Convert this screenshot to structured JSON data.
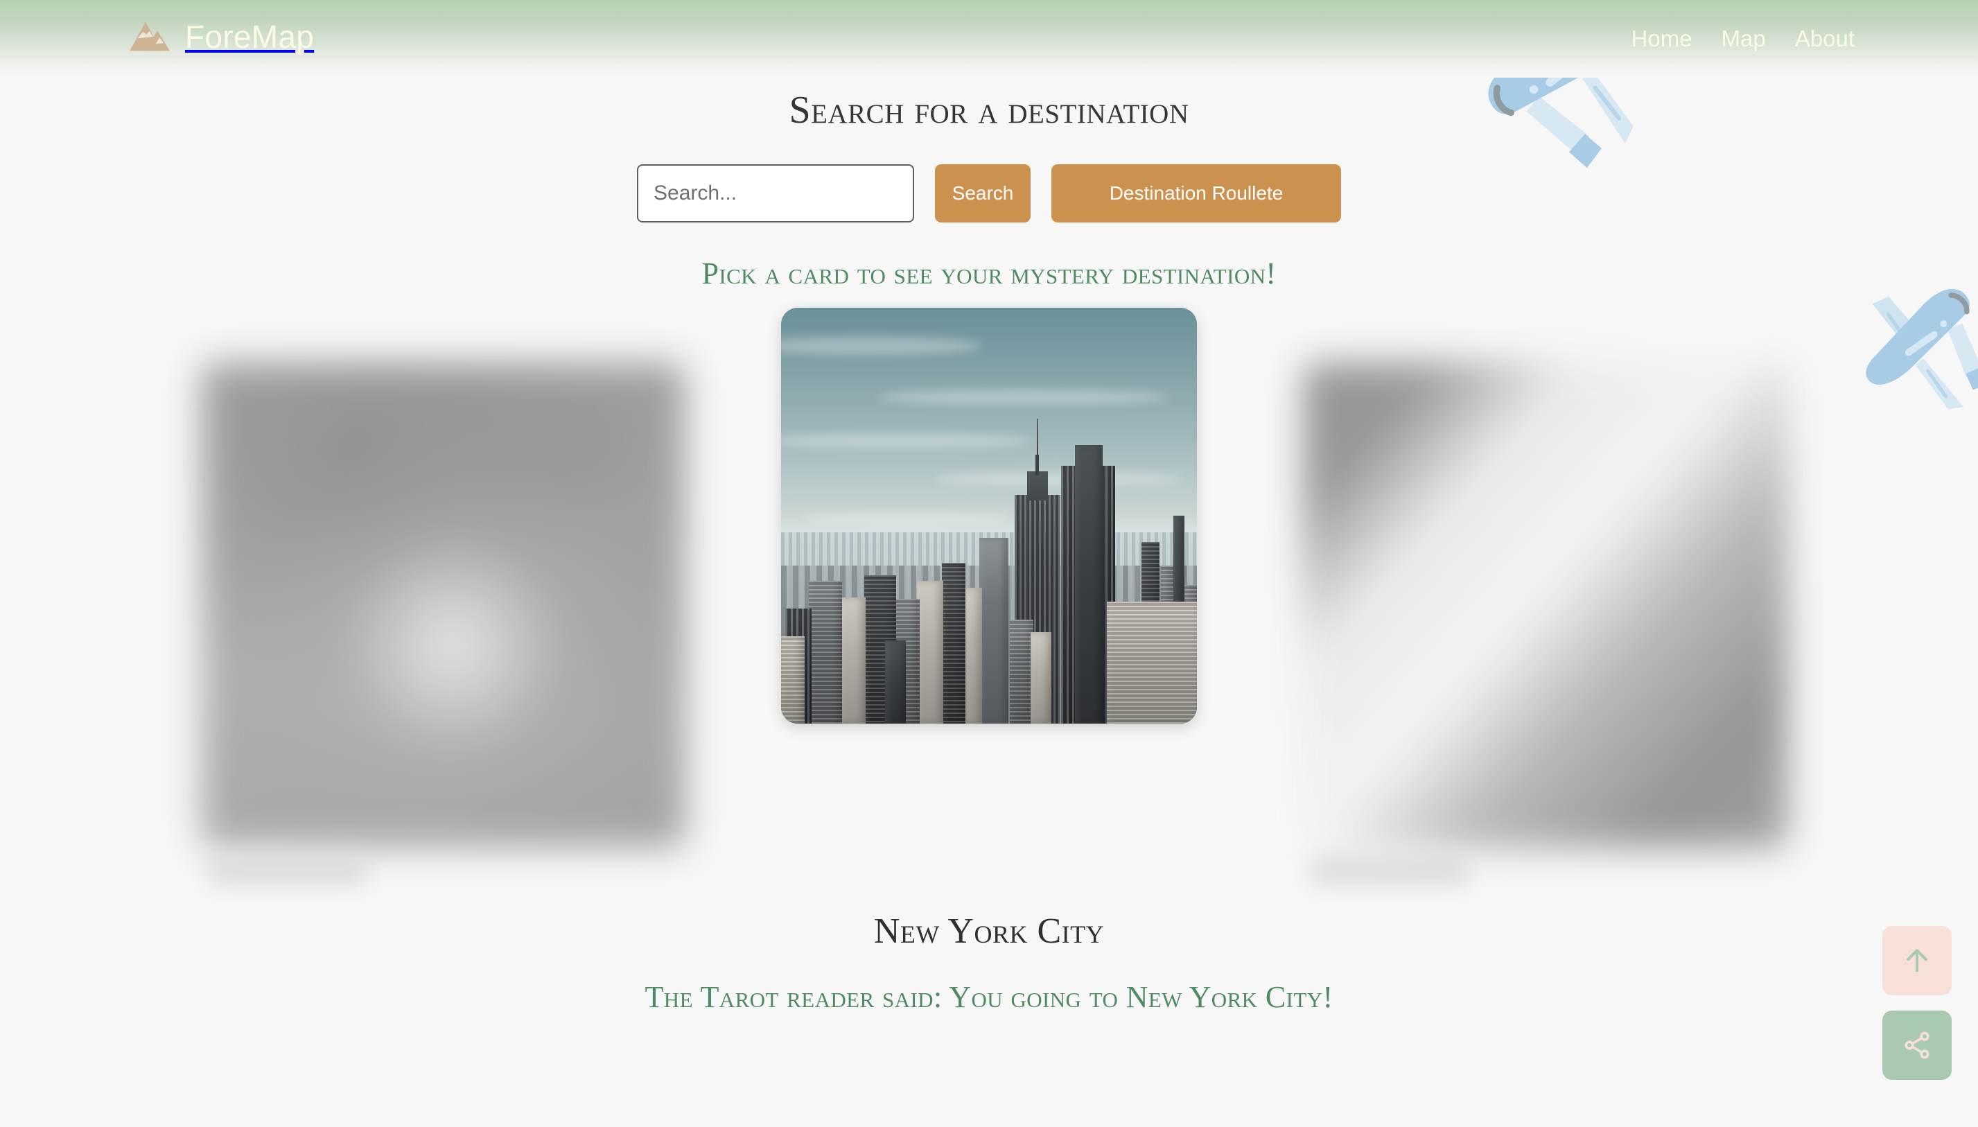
{
  "header": {
    "brand_name": "ForeMap",
    "logo_icon": "mountain-icon",
    "nav": [
      {
        "label": "Home"
      },
      {
        "label": "Map"
      },
      {
        "label": "About"
      }
    ]
  },
  "search_section": {
    "title": "Search for a destination",
    "input_placeholder": "Search...",
    "input_value": "",
    "search_button_label": "Search",
    "roulette_button_label": "Destination Roullete"
  },
  "roulette_section": {
    "heading": "Pick a card to see your mystery destination!",
    "destination_name": "New York City",
    "tarot_message": "The Tarot reader said: You going to New York City!",
    "cards": [
      {
        "state": "hidden",
        "name": "mystery-card-left"
      },
      {
        "state": "revealed",
        "name": "mystery-card-center",
        "image_alt": "New York City skyline"
      },
      {
        "state": "hidden",
        "name": "mystery-card-right"
      }
    ]
  },
  "floating_actions": [
    {
      "name": "scroll-to-top-button",
      "icon": "arrow-up-icon",
      "background": "#f7e0d8",
      "foreground": "#a9c9b1"
    },
    {
      "name": "share-button",
      "icon": "share-icon",
      "background": "#a9c9b1",
      "foreground": "#f7e0d8"
    }
  ],
  "theme": {
    "page_background": "#f7f7f7",
    "header_gradient_start": "#b6cfb4",
    "brand_text": "#fbfbe4",
    "accent_button": "#cd914f",
    "heading_dark": "#363636",
    "heading_green": "#4f8a62",
    "logo_tan": "#cfb395",
    "plane_blue": "#a8cbe6"
  }
}
